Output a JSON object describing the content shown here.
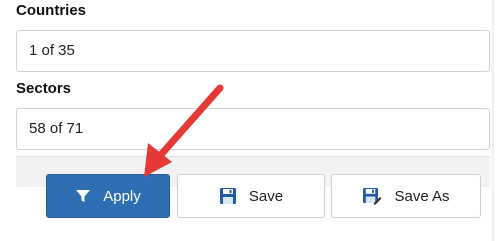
{
  "countries": {
    "label": "Countries",
    "value": "1 of 35"
  },
  "sectors": {
    "label": "Sectors",
    "value": "58 of 71"
  },
  "buttons": {
    "apply": "Apply",
    "save": "Save",
    "save_as": "Save As"
  },
  "colors": {
    "apply_bg": "#2e6fb4",
    "arrow": "#e53935",
    "save_icon": "#1f5aa6"
  },
  "icons": {
    "apply": "filter-icon",
    "save": "floppy-disk-icon",
    "save_as": "floppy-disk-pencil-icon",
    "annotation": "red-arrow"
  }
}
